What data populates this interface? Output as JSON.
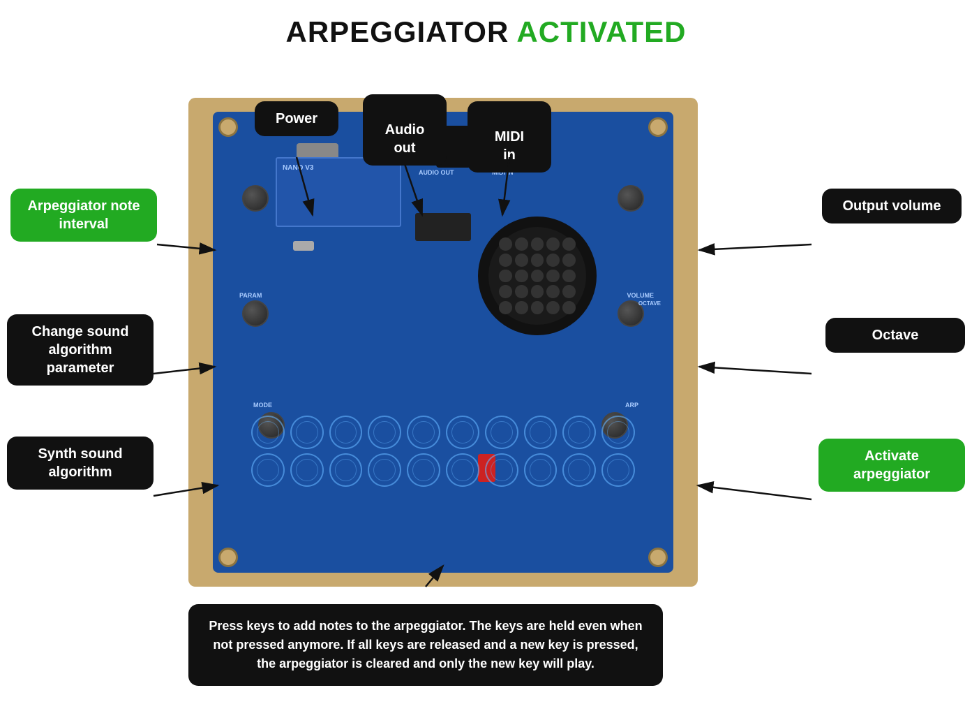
{
  "title": {
    "normal": "ARPEGGIATOR ",
    "green": "ACTIVATED"
  },
  "labels": {
    "power": "Power",
    "audio_out": "Audio\nout",
    "midi_in": "MIDI\nin",
    "arp_note_interval": "Arpeggiator\nnote interval",
    "change_sound_param": "Change\nsound\nalgorithm\nparameter",
    "synth_sound": "Synth sound\nalgorithm",
    "output_volume": "Output\nvolume",
    "octave": "Octave",
    "activate_arp": "Activate\narpeggiator",
    "bottom_text": "Press keys to add notes to the arpeggiator. The keys are held even when not pressed anymore. If all keys are released and a new key is pressed, the arpeggiator is cleared and only the new key will play."
  },
  "pcb": {
    "audio_out_label": "AUDIO OUT",
    "midi_in_label": "MIDI IN",
    "param_label": "PARAM",
    "volume_label": "VOLUME",
    "octave_label": "OCTAVE",
    "mode_label": "MODE",
    "arp_label": "ARP"
  }
}
